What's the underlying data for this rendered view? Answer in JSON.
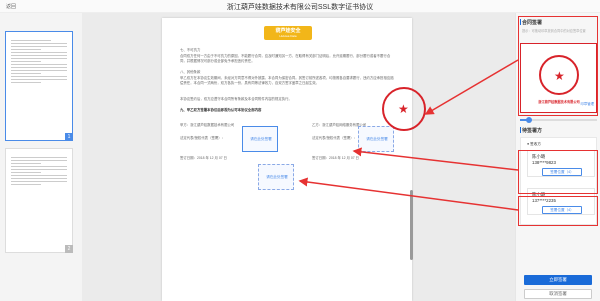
{
  "header": {
    "back_label": "返回",
    "title": "浙江葫芦娃数据技术有限公司SSL数字证书协议"
  },
  "thumbnails": {
    "items": [
      {
        "page": "1"
      },
      {
        "page": "2"
      }
    ]
  },
  "document": {
    "logo_cn": "葫芦娃安全",
    "logo_en": "Huluwa Data",
    "paragraphs": [
      "七、不可抗力",
      "合同双方任何一方由于不可抗力的原因，不能履行合同，应及时通知另一方，在取得有关部门证明后，允许延期履行、部分履行或者不履行合同，并根据情况可部分或全部免予承担违约责任。",
      "八、其他条款",
      "甲乙双方在本协议生效期间，未经对方同意不得对外披露，本合同为保密合同。其签订前所述各项，均按照各自要求履行，违约方应承担相应赔偿责任，本合同一式两份，双方各执一份，具有同等法律效力，自双方签字盖章之日起生效。",
      "本协议签约后，双方应遵守本合同所有条款及本合同附件内容的规定执行。",
      "九、甲乙双方签署本协议后即视为认可本协议全部内容"
    ],
    "party_a_label": "甲方：浙江葫芦娃数据技术有限公司",
    "party_b_label": "乙方：浙江葫芦娃网络服务有限公司",
    "rep_a_label": "法定代表/授权代表（签署）：",
    "rep_b_label": "法定代表/授权代表（签署）：",
    "date_a_label": "签订日期：2018 年 12 月 07 日",
    "date_b_label": "签订日期：2018 年 12 月 07 日",
    "sign_box_label": "请在此处签署",
    "sign_box_label_2": "请在此处签署",
    "sign_box_label_3": "请在此处签署",
    "seal_text": "浙江葫芦娃数据技术有限公司"
  },
  "panel": {
    "seal_section_title": "合同签署",
    "seal_hint": "提示：可拖动印章放到合同中的对应签章位置",
    "seal_text": "浙江葫芦娃数据技术有限公司",
    "seal_manage_link": "印章管理",
    "slider_value": 0.12,
    "signer_section_title": "待签署方",
    "signer_radio_label": "签收方",
    "signers": [
      {
        "name": "陈小璐",
        "phone": "138****9823",
        "button": "签署位置（4）"
      },
      {
        "name": "陈小璐",
        "phone": "137****2235",
        "button": "签署位置（4）"
      }
    ],
    "confirm_button": "立即签署",
    "cancel_button": "取消签署"
  },
  "colors": {
    "primary": "#1a6bd8",
    "seal_red": "#d8232a",
    "highlight_red": "#e63232",
    "logo_yellow": "#f2b619"
  }
}
